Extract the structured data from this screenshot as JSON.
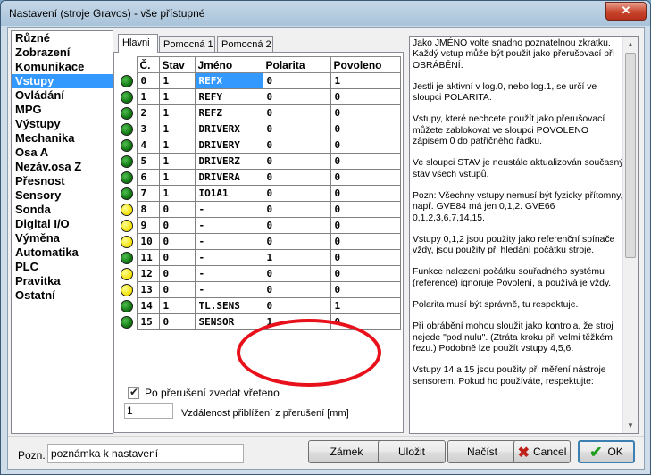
{
  "window": {
    "title": "Nastavení (stroje Gravos) - vše přístupné",
    "close_glyph": "✕"
  },
  "sidebar": {
    "items": [
      "Různé",
      "Zobrazení",
      "Komunikace",
      "Vstupy",
      "Ovládání",
      "MPG",
      "Výstupy",
      "Mechanika",
      "Osa A",
      "Nezáv.osa Z",
      "Přesnost",
      "Sensory",
      "Sonda",
      "Digital I/O",
      "Výměna",
      "Automatika",
      "PLC",
      "Pravitka",
      "Ostatní"
    ],
    "selected_index": 3
  },
  "tabs": [
    "Hlavni",
    "Pomocná 1",
    "Pomocná 2"
  ],
  "active_tab": 0,
  "table": {
    "headers": [
      "Č.",
      "Stav",
      "Jméno",
      "Polarita",
      "Povoleno"
    ],
    "rows": [
      {
        "led": "green",
        "num": "0",
        "stav": "1",
        "name": "REFX",
        "pol": "0",
        "pov": "1"
      },
      {
        "led": "green",
        "num": "1",
        "stav": "1",
        "name": "REFY",
        "pol": "0",
        "pov": "0"
      },
      {
        "led": "green",
        "num": "2",
        "stav": "1",
        "name": "REFZ",
        "pol": "0",
        "pov": "0"
      },
      {
        "led": "green",
        "num": "3",
        "stav": "1",
        "name": "DRIVERX",
        "pol": "0",
        "pov": "0"
      },
      {
        "led": "green",
        "num": "4",
        "stav": "1",
        "name": "DRIVERY",
        "pol": "0",
        "pov": "0"
      },
      {
        "led": "green",
        "num": "5",
        "stav": "1",
        "name": "DRIVERZ",
        "pol": "0",
        "pov": "0"
      },
      {
        "led": "green",
        "num": "6",
        "stav": "1",
        "name": "DRIVERA",
        "pol": "0",
        "pov": "0"
      },
      {
        "led": "green",
        "num": "7",
        "stav": "1",
        "name": "IO1A1",
        "pol": "0",
        "pov": "0"
      },
      {
        "led": "yellow",
        "num": "8",
        "stav": "0",
        "name": "-",
        "pol": "0",
        "pov": "0"
      },
      {
        "led": "yellow",
        "num": "9",
        "stav": "0",
        "name": "-",
        "pol": "0",
        "pov": "0"
      },
      {
        "led": "yellow",
        "num": "10",
        "stav": "0",
        "name": "-",
        "pol": "0",
        "pov": "0"
      },
      {
        "led": "green",
        "num": "11",
        "stav": "0",
        "name": "-",
        "pol": "1",
        "pov": "0"
      },
      {
        "led": "yellow",
        "num": "12",
        "stav": "0",
        "name": "-",
        "pol": "0",
        "pov": "0"
      },
      {
        "led": "yellow",
        "num": "13",
        "stav": "0",
        "name": "-",
        "pol": "0",
        "pov": "0"
      },
      {
        "led": "green",
        "num": "14",
        "stav": "1",
        "name": "TL.SENS",
        "pol": "0",
        "pov": "1"
      },
      {
        "led": "green",
        "num": "15",
        "stav": "0",
        "name": "SENSOR",
        "pol": "1",
        "pov": "0"
      }
    ]
  },
  "options": {
    "interrupt_checkbox_label": "Po přerušení zvedat vřeteno",
    "interrupt_checked": true,
    "check_glyph": "✔",
    "distance_value": "1",
    "distance_label": "Vzdálenost přiblížení z přerušení [mm]"
  },
  "help": {
    "paragraphs": [
      "Jako JMÉNO volte snadno poznatelnou zkratku. Každý vstup může být použit jako přerušovací při OBRÁBĚNÍ.",
      "Jestli je aktivní v log.0, nebo log.1, se určí ve sloupci POLARITA.",
      "Vstupy, které nechcete použít jako přerušovací můžete zablokovat ve sloupci POVOLENO zápisem 0 do patřičného řádku.",
      "Ve sloupci STAV je neustále aktualizován současný stav všech vstupů.",
      "Pozn: Všechny vstupy nemusí být fyzicky přítomny,\nnapř. GVE84 má jen 0,1,2. GVE66 0,1,2,3,6,7,14,15.",
      "Vstupy 0,1,2 jsou použity jako referenční spínače vždy, jsou použity při hledání počátku stroje.",
      "Funkce nalezení počátku souřadného systému (reference) ignoruje Povolení, a používá je vždy.",
      "Polarita musí být správně, tu respektuje.",
      "Při obrábění mohou sloužit jako kontrola, že stroj nejede \"pod nulu\". (Ztráta kroku při velmi těžkém řezu.) Podobně lze použít vstupy 4,5,6.",
      "Vstupy 14 a 15 jsou použity při měření nástroje sensorem. Pokud ho používáte, respektujte:"
    ],
    "scroll_up_glyph": "▲",
    "scroll_down_glyph": "▼"
  },
  "bottom": {
    "note_label": "Pozn.",
    "note_value": "poznámka k nastavení",
    "lock_label": "Zámek",
    "save_label": "Uložit",
    "load_label": "Načíst",
    "cancel_label": "Cancel",
    "ok_label": "OK",
    "cancel_glyph": "✖",
    "ok_glyph": "✔"
  },
  "colors": {
    "selection": "#3399ff",
    "annotation": "#e8101a",
    "led_on": "#0c6e0c",
    "led_off": "#f4e000"
  }
}
